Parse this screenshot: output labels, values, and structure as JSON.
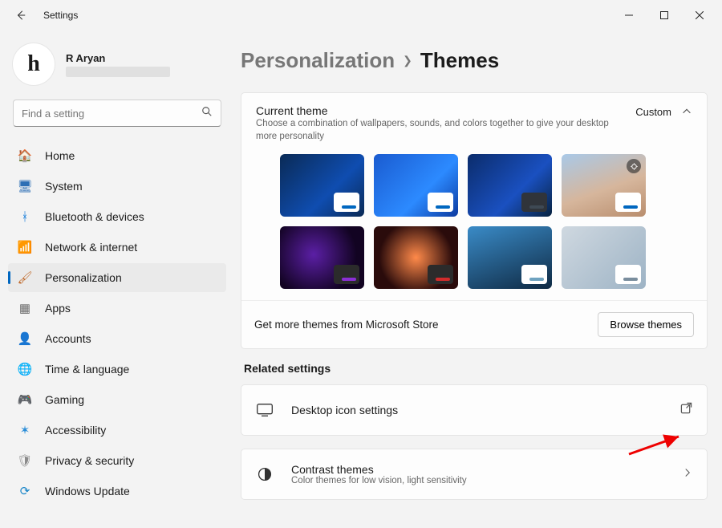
{
  "window": {
    "title": "Settings"
  },
  "user": {
    "name": "R Aryan"
  },
  "search": {
    "placeholder": "Find a setting"
  },
  "nav": [
    {
      "label": "Home",
      "icon": "🏠",
      "color": "#d77a3d"
    },
    {
      "label": "System",
      "icon": "🖥",
      "color": "#2e6fb5"
    },
    {
      "label": "Bluetooth & devices",
      "icon": "ᚼ",
      "color": "#0a76d8"
    },
    {
      "label": "Network & internet",
      "icon": "📶",
      "color": "#17b1d1"
    },
    {
      "label": "Personalization",
      "icon": "🖌",
      "color": "#c06a2b",
      "selected": true
    },
    {
      "label": "Apps",
      "icon": "▦",
      "color": "#6b6b6b"
    },
    {
      "label": "Accounts",
      "icon": "👤",
      "color": "#3aa06a"
    },
    {
      "label": "Time & language",
      "icon": "🌐",
      "color": "#2aa3b5"
    },
    {
      "label": "Gaming",
      "icon": "🎮",
      "color": "#6b6b6b"
    },
    {
      "label": "Accessibility",
      "icon": "✶",
      "color": "#2a8dd8"
    },
    {
      "label": "Privacy & security",
      "icon": "🛡",
      "color": "#8a8a8a"
    },
    {
      "label": "Windows Update",
      "icon": "⟳",
      "color": "#1a86c9"
    }
  ],
  "breadcrumb": {
    "parent": "Personalization",
    "current": "Themes"
  },
  "currentTheme": {
    "title": "Current theme",
    "subtitle": "Choose a combination of wallpapers, sounds, and colors together to give your desktop more personality",
    "value": "Custom"
  },
  "themes": [
    {
      "bg": "linear-gradient(135deg,#0a2a55,#0f4db0 60%,#0a2a55)",
      "accent": "#0067c0"
    },
    {
      "bg": "linear-gradient(135deg,#1a5bd0,#2c8aff 60%,#0c3aa0)",
      "accent": "#0067c0"
    },
    {
      "bg": "linear-gradient(135deg,#0b2c6b,#1a50c0 60%,#07223f)",
      "accent": "#3e4954",
      "swatch": "#30343a"
    },
    {
      "bg": "linear-gradient(160deg,#a9c9e8,#d6b69c 55%,#b98e6e)",
      "accent": "#0067c0",
      "badge": true
    },
    {
      "bg": "radial-gradient(circle at 40% 45%,#5b1fa5,#120322 70%)",
      "accent": "#8b2fd4",
      "swatch": "#2b2b2b"
    },
    {
      "bg": "radial-gradient(circle at 50% 50%,#ff8a4a,#2a0b0b 70%)",
      "accent": "#d12b2b",
      "swatch": "#2b2b2b"
    },
    {
      "bg": "linear-gradient(160deg,#3a8bc7,#0f2a44)",
      "accent": "#6fa3c0"
    },
    {
      "bg": "linear-gradient(135deg,#cfd8e0,#9db3c5)",
      "accent": "#7a8e9e"
    }
  ],
  "store": {
    "text": "Get more themes from Microsoft Store",
    "button": "Browse themes"
  },
  "related": {
    "title": "Related settings",
    "row1": {
      "title": "Desktop icon settings"
    },
    "row2": {
      "title": "Contrast themes",
      "subtitle": "Color themes for low vision, light sensitivity"
    }
  }
}
